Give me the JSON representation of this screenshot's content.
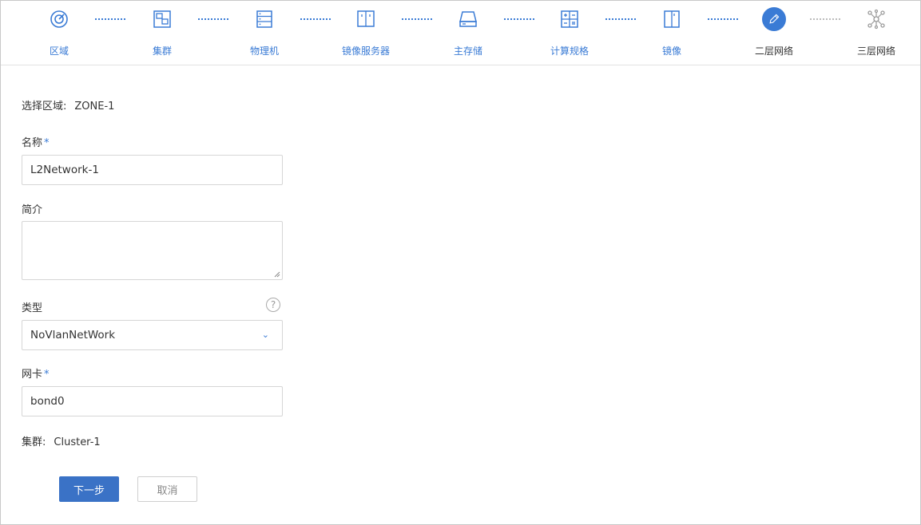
{
  "wizard": {
    "steps": [
      {
        "label": "区域",
        "icon": "zone-icon",
        "state": "done"
      },
      {
        "label": "集群",
        "icon": "cluster-icon",
        "state": "done"
      },
      {
        "label": "物理机",
        "icon": "host-icon",
        "state": "done"
      },
      {
        "label": "镜像服务器",
        "icon": "backup-storage-icon",
        "state": "done"
      },
      {
        "label": "主存储",
        "icon": "primary-storage-icon",
        "state": "done"
      },
      {
        "label": "计算规格",
        "icon": "instance-offering-icon",
        "state": "done"
      },
      {
        "label": "镜像",
        "icon": "image-icon",
        "state": "done"
      },
      {
        "label": "二层网络",
        "icon": "pencil-icon",
        "state": "current"
      },
      {
        "label": "三层网络",
        "icon": "network-icon",
        "state": "future"
      }
    ]
  },
  "form": {
    "zone_label": "选择区域:",
    "zone_value": "ZONE-1",
    "name_label": "名称",
    "required_mark": "*",
    "name_value": "L2Network-1",
    "desc_label": "简介",
    "desc_value": "",
    "type_label": "类型",
    "help_glyph": "?",
    "type_value": "NoVlanNetWork",
    "nic_label": "网卡",
    "nic_value": "bond0",
    "cluster_label": "集群:",
    "cluster_value": "Cluster-1"
  },
  "actions": {
    "next_label": "下一步",
    "cancel_label": "取消"
  },
  "colors": {
    "accent": "#3a7bd5",
    "primary_button": "#3a72c6",
    "border": "#d6d6d6"
  }
}
